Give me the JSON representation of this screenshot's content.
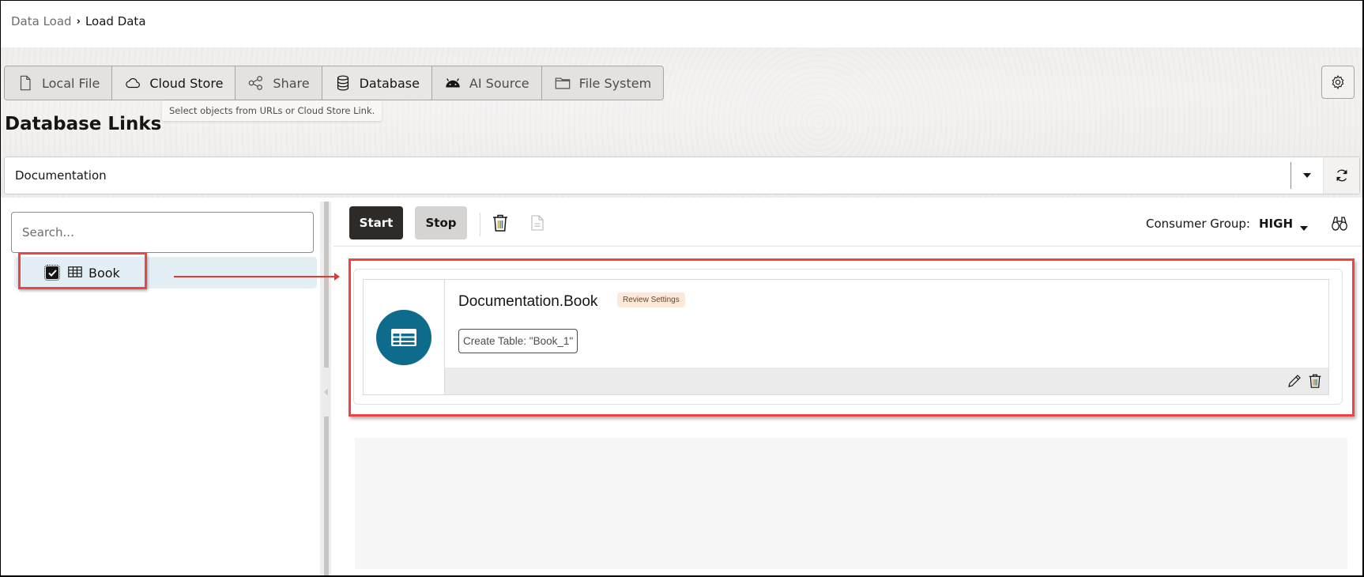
{
  "breadcrumb": {
    "parent": "Data Load",
    "separator": "›",
    "current": "Load Data"
  },
  "tabs": [
    {
      "label": "Local File",
      "icon": "file-icon",
      "active": false
    },
    {
      "label": "Cloud Store",
      "icon": "cloud-icon",
      "active": false
    },
    {
      "label": "Share",
      "icon": "share-icon",
      "active": false
    },
    {
      "label": "Database",
      "icon": "database-icon",
      "active": true
    },
    {
      "label": "AI Source",
      "icon": "android-icon",
      "active": false
    },
    {
      "label": "File System",
      "icon": "folder-icon",
      "active": false
    }
  ],
  "tooltip": "Select objects from URLs or Cloud Store Link.",
  "settings": {
    "icon": "gear-icon"
  },
  "page_title": "Database Links",
  "db_link_select": {
    "value": "Documentation",
    "caret_icon": "caret-down-icon",
    "refresh_icon": "refresh-icon"
  },
  "left_panel": {
    "search_placeholder": "Search...",
    "search_value": "",
    "tree": [
      {
        "label": "Book",
        "checked": true,
        "icon": "table-icon"
      }
    ]
  },
  "toolbar": {
    "start_label": "Start",
    "stop_label": "Stop",
    "delete_icon": "trash-icon",
    "report_icon": "document-icon",
    "consumer_group_label": "Consumer Group:",
    "consumer_group_value": "HIGH",
    "search_icon": "binoculars-icon"
  },
  "cards": [
    {
      "title": "Documentation.Book",
      "badge": "Review Settings",
      "action": "Create Table: \"Book_1\"",
      "icon": "table-icon",
      "edit_icon": "pencil-icon",
      "delete_icon": "trash-icon"
    }
  ],
  "colors": {
    "accent_circle": "#0f6b8c",
    "highlight": "#ef4444",
    "start_button": "#2d2a27",
    "badge_bg": "#fbeadb",
    "selected_row": "#e4eef5"
  }
}
